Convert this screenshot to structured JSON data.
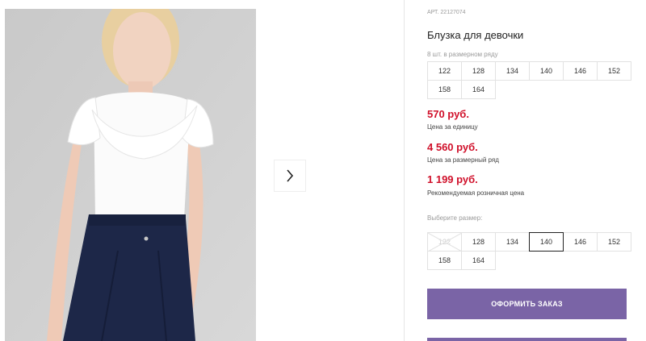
{
  "product": {
    "sku": "АРТ. 22127074",
    "title": "Блузка для девочки"
  },
  "pack": {
    "label": "8 шт. в размерном ряду",
    "sizes": [
      "122",
      "128",
      "134",
      "140",
      "146",
      "152",
      "158",
      "164"
    ]
  },
  "prices": [
    {
      "value": "570 руб.",
      "note": "Цена за единицу"
    },
    {
      "value": "4 560 руб.",
      "note": "Цена за размерный ряд"
    },
    {
      "value": "1 199 руб.",
      "note": "Рекомендуемая розничная цена"
    }
  ],
  "size_select": {
    "label": "Выберите размер:",
    "sizes": [
      "122",
      "128",
      "134",
      "140",
      "146",
      "152",
      "158",
      "164"
    ],
    "selected": "140",
    "disabled": [
      "122"
    ]
  },
  "order_button": {
    "label": "ОФОРМИТЬ ЗАКАЗ"
  },
  "gallery": {
    "next_icon": "chevron-right-icon"
  },
  "colors": {
    "price": "#d0102a",
    "button": "#7a64a6",
    "selected_border": "#222222"
  }
}
